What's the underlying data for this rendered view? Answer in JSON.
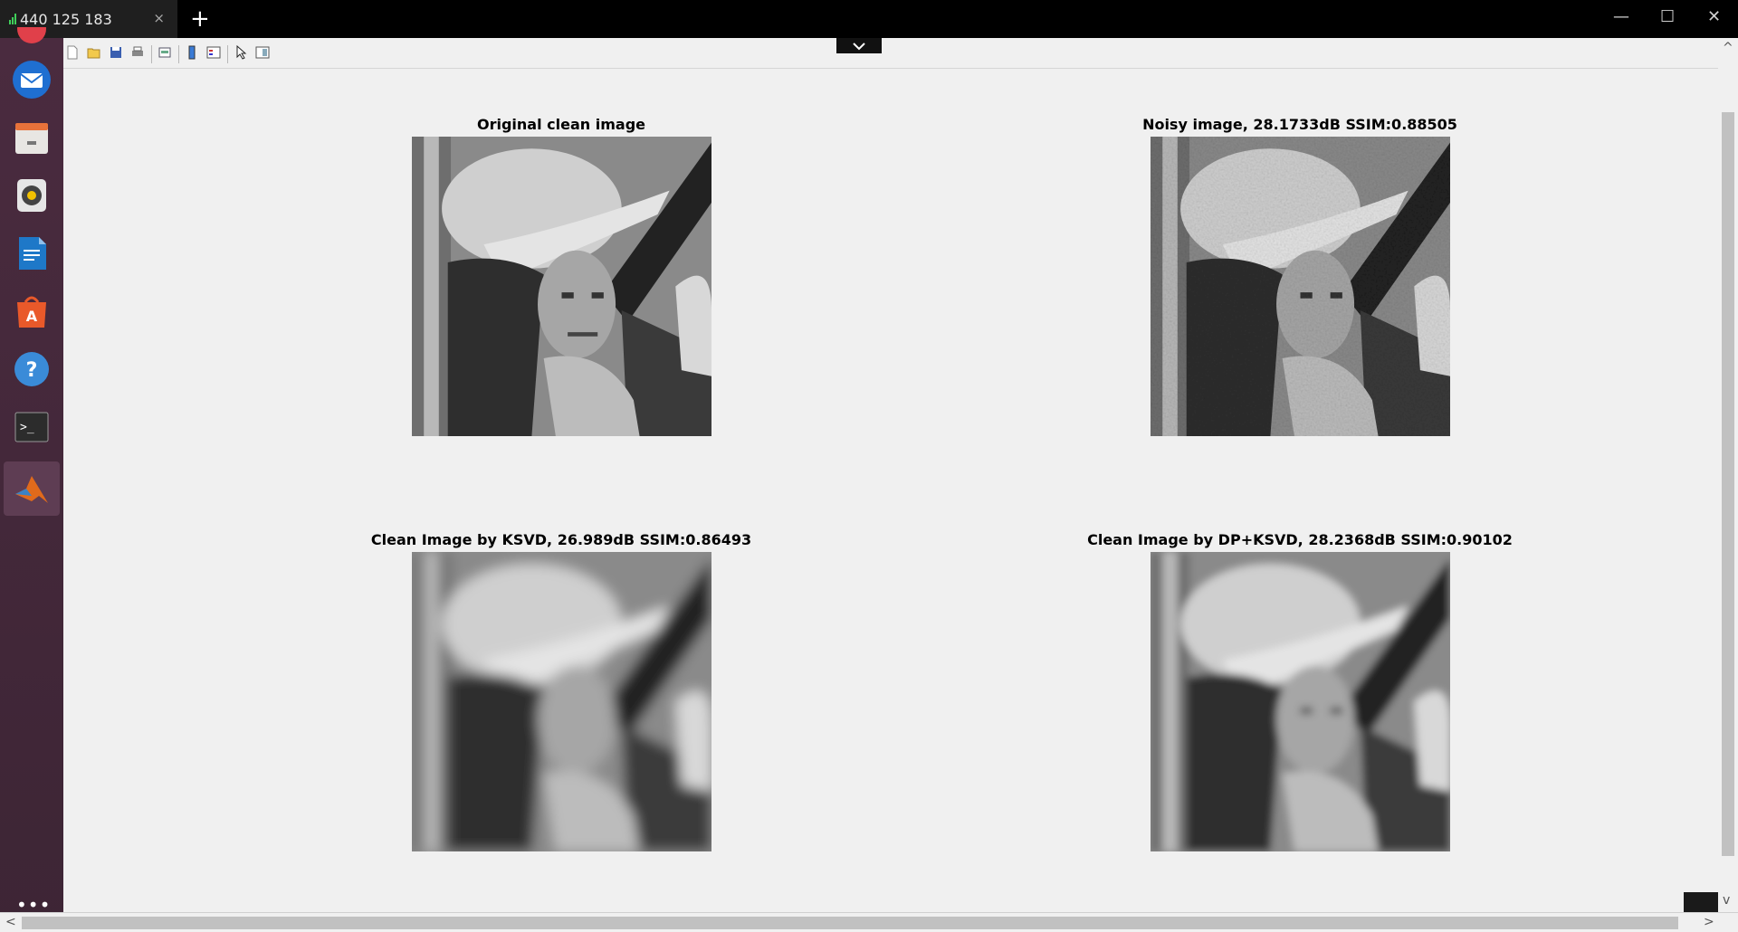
{
  "session": {
    "tab_label": "440 125 183",
    "tab_close": "×",
    "new_tab": "+",
    "minimize": "—",
    "maximize": "☐",
    "close": "✕"
  },
  "launcher": {
    "items": [
      "thunderbird-icon",
      "files-icon",
      "rhythmbox-icon",
      "writer-icon",
      "software-center-icon",
      "help-icon",
      "terminal-icon",
      "matlab-icon"
    ],
    "more": "•••"
  },
  "toolbar": {
    "buttons": [
      "new-figure-icon",
      "open-file-icon",
      "save-icon",
      "print-icon",
      "print-preview-icon",
      "colorbar-icon",
      "legend-icon",
      "pointer-icon",
      "property-editor-icon"
    ],
    "collapse": "⌄"
  },
  "figure": {
    "panels": [
      {
        "title": "Original clean image"
      },
      {
        "title": "Noisy image, 28.1733dB SSIM:0.88505"
      },
      {
        "title": "Clean Image by KSVD, 26.989dB SSIM:0.86493"
      },
      {
        "title": "Clean Image by DP+KSVD, 28.2368dB SSIM:0.90102"
      }
    ]
  },
  "scrollbars": {
    "left_arrow": "<",
    "right_arrow": ">",
    "up_arrow": "^",
    "down_arrow": "v"
  },
  "colors": {
    "launcher_bg": "#4a2b3f",
    "figure_bg": "#f0f0f0",
    "title_bar": "#000000"
  }
}
